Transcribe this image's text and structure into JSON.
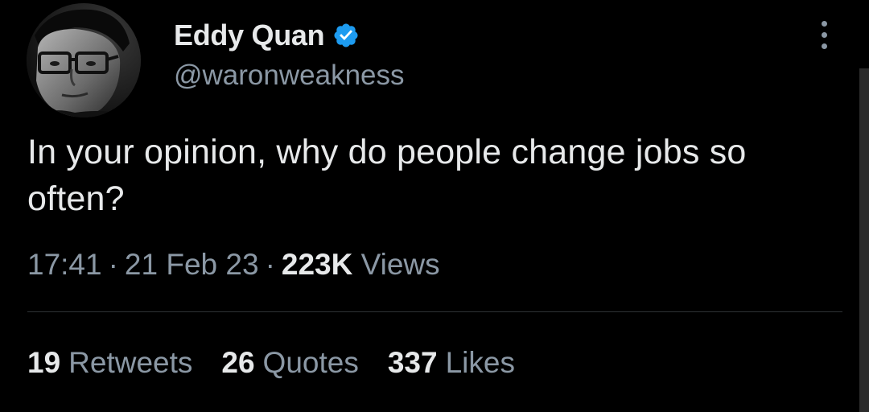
{
  "author": {
    "display_name": "Eddy Quan",
    "handle": "@waronweakness",
    "verified": true,
    "avatar_icon": "profile-photo"
  },
  "colors": {
    "background": "#000000",
    "primary_text": "#e7e9ea",
    "secondary_text": "#8b98a5",
    "verified_badge": "#1d9bf0",
    "divider": "#2f3336"
  },
  "tweet": {
    "text": "In your opinion, why do people change jobs so often?",
    "time": "17:41",
    "date": "21 Feb 23",
    "views_count": "223K",
    "views_label": "Views",
    "separator": "·"
  },
  "stats": {
    "retweets_count": "19",
    "retweets_label": "Retweets",
    "quotes_count": "26",
    "quotes_label": "Quotes",
    "likes_count": "337",
    "likes_label": "Likes"
  },
  "icons": {
    "more": "more-vertical-icon",
    "verified": "verified-badge-icon"
  }
}
